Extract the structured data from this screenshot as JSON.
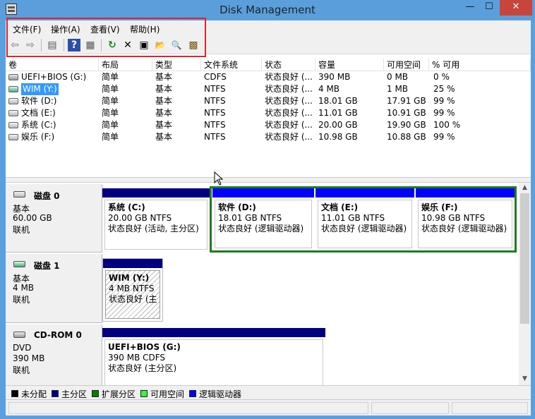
{
  "window": {
    "title": "Disk Management",
    "min": "—",
    "max": "☐",
    "close": "✕"
  },
  "menu": [
    "文件(F)",
    "操作(A)",
    "查看(V)",
    "帮助(H)"
  ],
  "toolbar": [
    {
      "icon": "back-arrow-icon",
      "glyph": "⇦"
    },
    {
      "icon": "forward-arrow-icon",
      "glyph": "⇨"
    },
    {
      "icon": "console-tree-icon",
      "glyph": "▤"
    },
    {
      "icon": "help-icon",
      "glyph": "?"
    },
    {
      "icon": "action-pane-icon",
      "glyph": "▦"
    },
    {
      "icon": "refresh-icon",
      "glyph": "↻"
    },
    {
      "icon": "delete-icon",
      "glyph": "✕"
    },
    {
      "icon": "properties-icon",
      "glyph": "▣"
    },
    {
      "icon": "open-folder-icon",
      "glyph": "📂"
    },
    {
      "icon": "search-icon",
      "glyph": "🔍"
    },
    {
      "icon": "settings-icon",
      "glyph": "▩"
    }
  ],
  "columns": [
    "卷",
    "布局",
    "类型",
    "文件系统",
    "状态",
    "容量",
    "可用空间",
    "% 可用"
  ],
  "volumes": [
    {
      "name": "UEFI+BIOS (G:)",
      "layout": "简单",
      "type": "基本",
      "fs": "CDFS",
      "status": "状态良好 (...",
      "capacity": "390 MB",
      "free": "0 MB",
      "pct": "0 %",
      "icon": "cd"
    },
    {
      "name": "WIM (Y:)",
      "layout": "简单",
      "type": "基本",
      "fs": "NTFS",
      "status": "状态良好 (...",
      "capacity": "4 MB",
      "free": "1 MB",
      "pct": "25 %",
      "icon": "green",
      "selected": true
    },
    {
      "name": "软件 (D:)",
      "layout": "简单",
      "type": "基本",
      "fs": "NTFS",
      "status": "状态良好 (...",
      "capacity": "18.01 GB",
      "free": "17.91 GB",
      "pct": "99 %",
      "icon": "drive"
    },
    {
      "name": "文档 (E:)",
      "layout": "简单",
      "type": "基本",
      "fs": "NTFS",
      "status": "状态良好 (...",
      "capacity": "11.01 GB",
      "free": "10.91 GB",
      "pct": "99 %",
      "icon": "drive"
    },
    {
      "name": "系统 (C:)",
      "layout": "简单",
      "type": "基本",
      "fs": "NTFS",
      "status": "状态良好 (...",
      "capacity": "20.00 GB",
      "free": "19.90 GB",
      "pct": "100 %",
      "icon": "drive"
    },
    {
      "name": "娱乐 (F:)",
      "layout": "简单",
      "type": "基本",
      "fs": "NTFS",
      "status": "状态良好 (...",
      "capacity": "10.98 GB",
      "free": "10.88 GB",
      "pct": "99 %",
      "icon": "drive"
    }
  ],
  "disks": [
    {
      "title": "磁盘 0",
      "type": "基本",
      "size": "60.00 GB",
      "state": "联机",
      "parts": [
        {
          "name": "系统  (C:)",
          "size": "20.00 GB NTFS",
          "status": "状态良好 (活动, 主分区)"
        },
        {
          "name": "软件  (D:)",
          "size": "18.01 GB NTFS",
          "status": "状态良好 (逻辑驱动器)"
        },
        {
          "name": "文档  (E:)",
          "size": "11.01 GB NTFS",
          "status": "状态良好 (逻辑驱动器)"
        },
        {
          "name": "娱乐  (F:)",
          "size": "10.98 GB NTFS",
          "status": "状态良好 (逻辑驱动器)"
        }
      ]
    },
    {
      "title": "磁盘 1",
      "type": "基本",
      "size": "4 MB",
      "state": "联机",
      "parts": [
        {
          "name": "WIM  (Y:)",
          "size": "4 MB NTFS",
          "status": "状态良好 (主"
        }
      ]
    },
    {
      "title": "CD-ROM 0",
      "type": "DVD",
      "size": "390 MB",
      "state": "联机",
      "parts": [
        {
          "name": "UEFI+BIOS  (G:)",
          "size": "390 MB CDFS",
          "status": "状态良好 (主分区)"
        }
      ]
    }
  ],
  "legend": [
    {
      "label": "未分配",
      "color": "#000000"
    },
    {
      "label": "主分区",
      "color": "#000080"
    },
    {
      "label": "扩展分区",
      "color": "#008000"
    },
    {
      "label": "可用空间",
      "color": "#33ff33"
    },
    {
      "label": "逻辑驱动器",
      "color": "#0000ff"
    }
  ],
  "colors": {
    "primary": "#000080",
    "logical": "#0000ff",
    "extended": "#1f7a1f",
    "accent": "#3399ff"
  }
}
